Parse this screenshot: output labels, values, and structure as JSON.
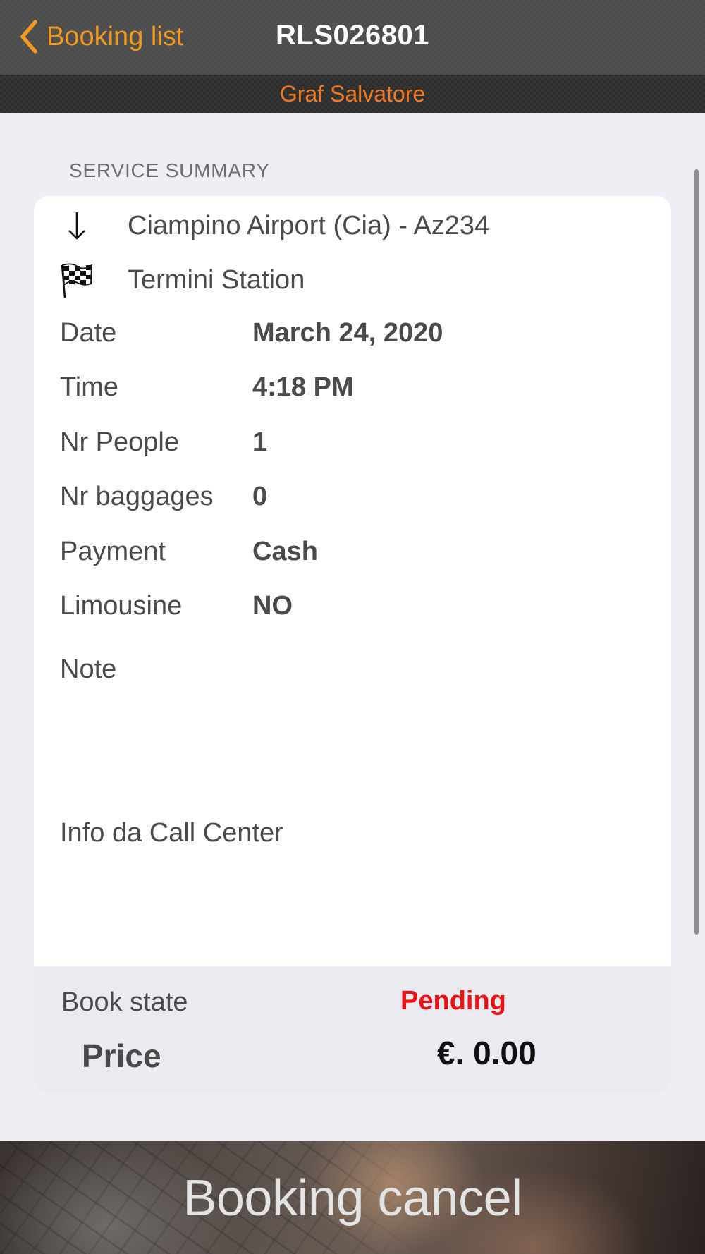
{
  "navbar": {
    "back_label": "Booking list",
    "title": "RLS026801",
    "accent_color": "#f29a1e"
  },
  "subheader": {
    "name": "Graf Salvatore",
    "color": "#f07a24"
  },
  "summary": {
    "section_title": "SERVICE SUMMARY",
    "route": {
      "pickup": {
        "icon": "arrow-down-icon",
        "text": "Ciampino Airport (Cia) - Az234"
      },
      "destination": {
        "icon": "checkered-flag-icon",
        "text": "Termini Station"
      }
    },
    "details": [
      {
        "label": "Date",
        "value": "March 24, 2020"
      },
      {
        "label": "Time",
        "value": "4:18 PM"
      },
      {
        "label": "Nr People",
        "value": "1"
      },
      {
        "label": "Nr baggages",
        "value": "0"
      },
      {
        "label": "Payment",
        "value": "Cash"
      },
      {
        "label": "Limousine",
        "value": "NO"
      }
    ],
    "note_label": "Note",
    "call_center_label": "Info da Call Center"
  },
  "status": {
    "state_label": "Book state",
    "state_value": "Pending",
    "state_color": "#ee1111",
    "price_label": "Price",
    "price_value": "€. 0.00"
  },
  "actions": {
    "cancel_label": "Booking cancel"
  }
}
